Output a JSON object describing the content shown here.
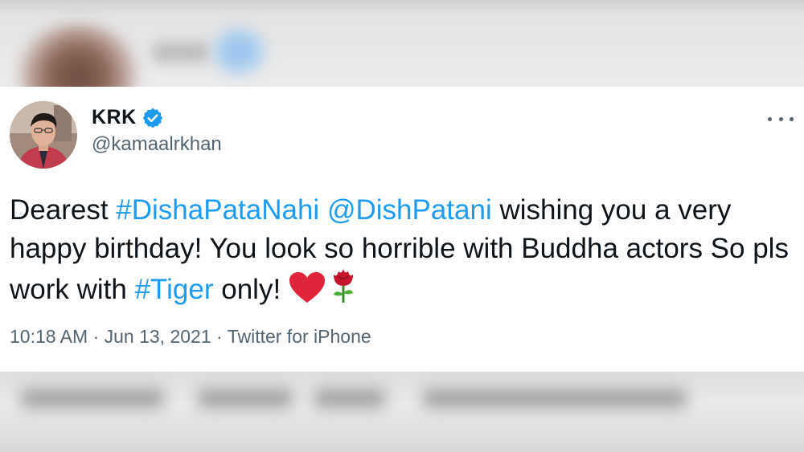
{
  "tweet": {
    "display_name": "KRK",
    "handle": "@kamaalrkhan",
    "text_parts": {
      "p1": "Dearest ",
      "hashtag1": "#DishaPataNahi",
      "p2": " ",
      "mention1": "@DishPatani",
      "p3": " wishing you a very happy birthday! You look so horrible with Buddha actors So pls work with ",
      "hashtag2": "#Tiger",
      "p4": " only! "
    },
    "time": "10:18 AM",
    "sep1": " · ",
    "date": "Jun 13, 2021",
    "sep2": " · ",
    "source": "Twitter for iPhone"
  },
  "icons": {
    "verified": "verified-badge-icon",
    "more": "more-options-icon",
    "emoji1": "red-heart-emoji",
    "emoji2": "rose-emoji"
  },
  "colors": {
    "link": "#1d9bf0",
    "text": "#0f1419",
    "secondary": "#536471",
    "verified": "#1d9bf0",
    "heart": "#e0243a"
  }
}
